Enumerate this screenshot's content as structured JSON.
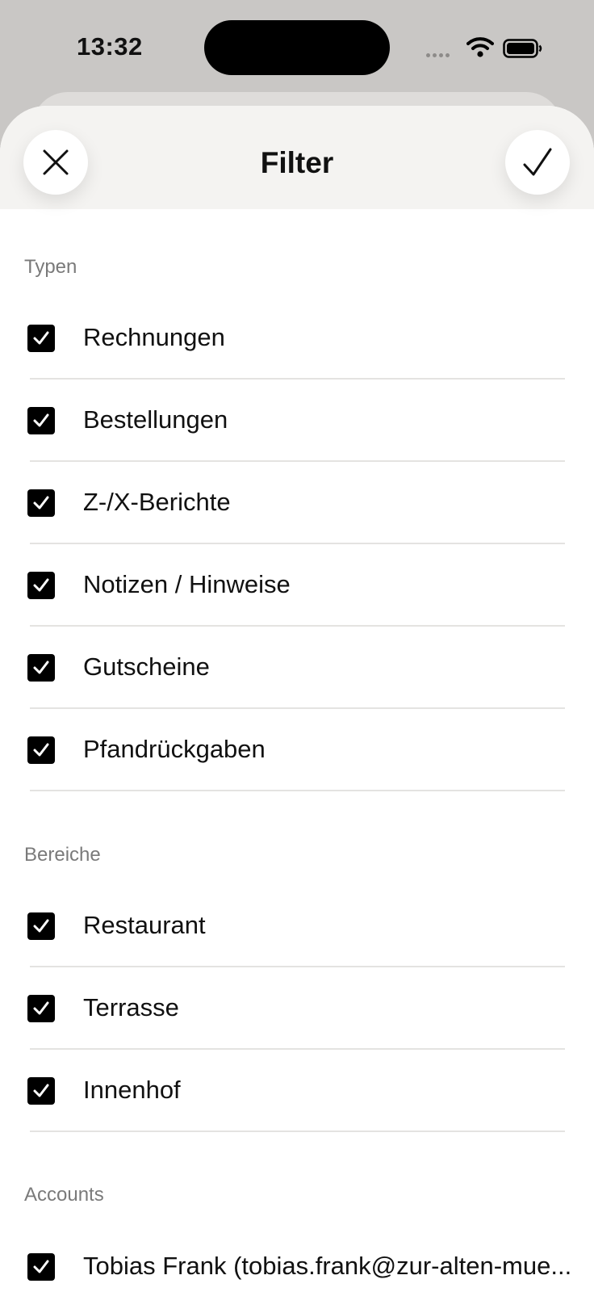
{
  "status_bar": {
    "time": "13:32"
  },
  "sheet": {
    "title": "Filter"
  },
  "sections": [
    {
      "label": "Typen",
      "items": [
        "Rechnungen",
        "Bestellungen",
        "Z-/X-Berichte",
        "Notizen / Hinweise",
        "Gutscheine",
        "Pfandrückgaben"
      ]
    },
    {
      "label": "Bereiche",
      "items": [
        "Restaurant",
        "Terrasse",
        "Innenhof"
      ]
    },
    {
      "label": "Accounts",
      "items": [
        "Tobias Frank (tobias.frank@zur-alten-mue..."
      ]
    }
  ],
  "colors": {
    "sheet_header_bg": "#f4f3f1",
    "checkbox": "#000000",
    "section_label": "#7a7a7a"
  }
}
